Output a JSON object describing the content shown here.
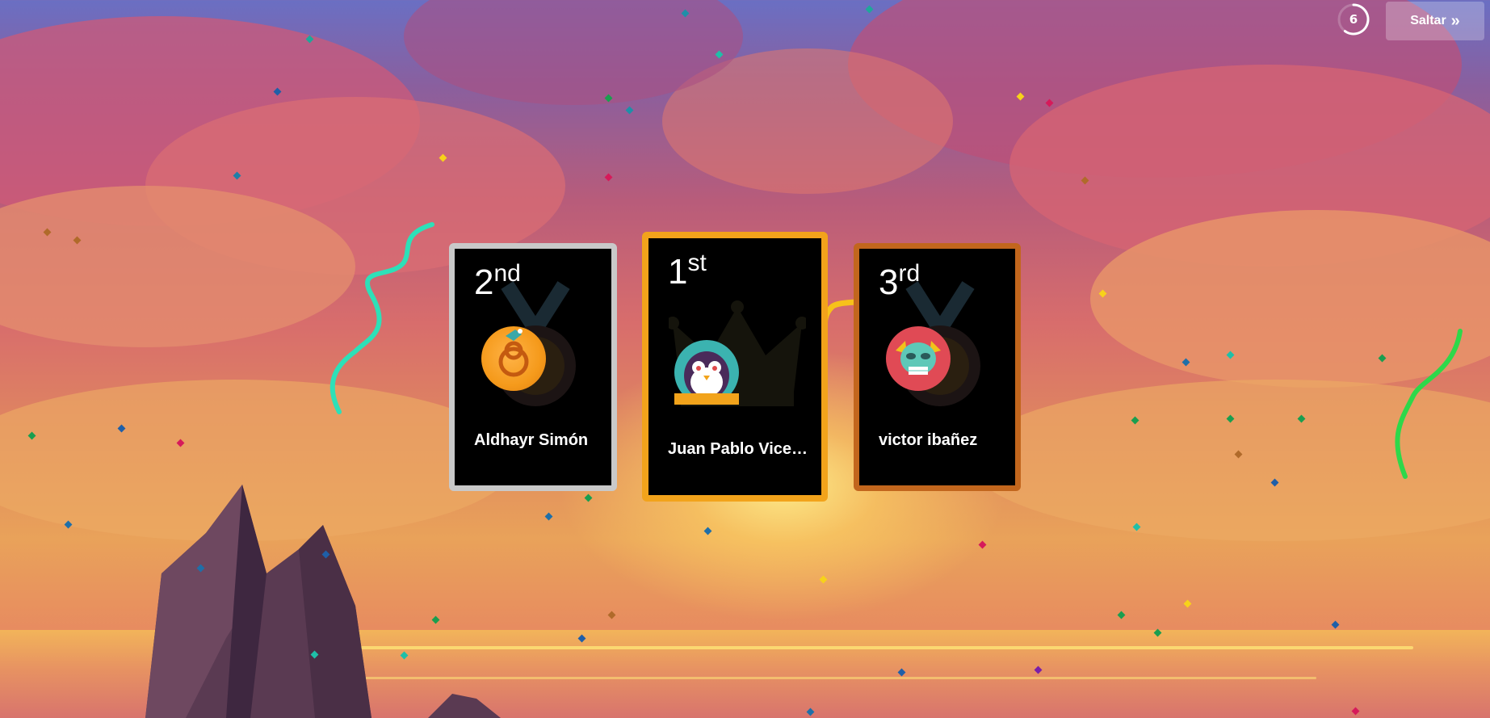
{
  "timer": {
    "seconds": "6",
    "progress": 0.6
  },
  "skip": {
    "label": "Saltar",
    "icon": "double-chevron-right-icon"
  },
  "podium": [
    {
      "place": "2",
      "suffix": "nd",
      "name": "Aldhayr Simón",
      "frame_color": "#c9c9c9",
      "avatar": "orange-creature-avatar-icon"
    },
    {
      "place": "1",
      "suffix": "st",
      "name": "Juan Pablo Vice…",
      "frame_color": "#f2a31b",
      "avatar": "penguin-owl-avatar-icon"
    },
    {
      "place": "3",
      "suffix": "rd",
      "name": "victor ibañez",
      "frame_color": "#c2661d",
      "avatar": "skull-monster-avatar-icon"
    }
  ],
  "background": {
    "scene": "sunset-sky-with-clouds-and-rocks",
    "confetti": true
  }
}
